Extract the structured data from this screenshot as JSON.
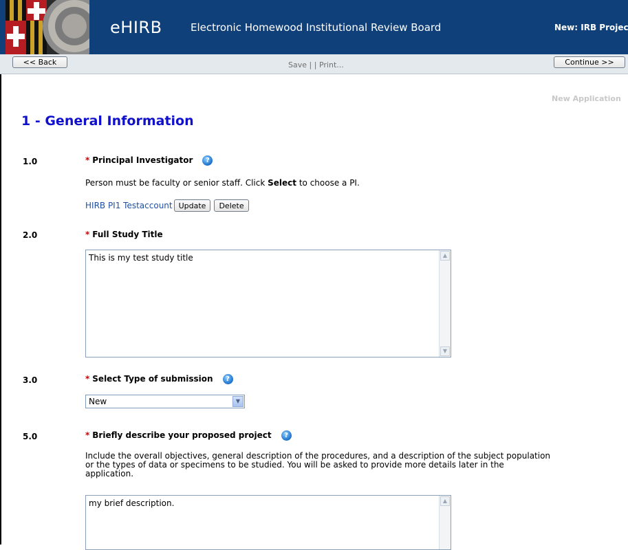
{
  "header": {
    "brand": "eHIRB",
    "subtitle": "Electronic Homewood Institutional Review Board",
    "right_title": "New: IRB Projec"
  },
  "toolbar": {
    "back_label": "<< Back",
    "save_label": "Save",
    "separator": "|",
    "print_label": "Print...",
    "continue_label": "Continue >>"
  },
  "page": {
    "new_application": "New Application",
    "section_title": "1 - General Information"
  },
  "questions": {
    "q1": {
      "number": "1.0",
      "required_mark": "*",
      "label": "Principal Investigator",
      "desc_before": "Person must be faculty or senior staff. Click ",
      "desc_bold": "Select",
      "desc_after": " to choose a PI.",
      "pi_name": "HIRB PI1 Testaccount",
      "update_label": "Update",
      "delete_label": "Delete"
    },
    "q2": {
      "number": "2.0",
      "required_mark": "*",
      "label": "Full Study Title",
      "value": "This is my test study title"
    },
    "q3": {
      "number": "3.0",
      "required_mark": "*",
      "label": "Select Type of submission",
      "selected": "New"
    },
    "q5": {
      "number": "5.0",
      "required_mark": "*",
      "label": "Briefly describe your proposed project",
      "desc_line1": "Include the overall objectives, general description of the procedures, and a description of the subject population",
      "desc_line2": "or the types of data or specimens to be studied.  You will be asked to provide more details later in the",
      "desc_line3": "application.",
      "value": "my brief description."
    }
  },
  "colors": {
    "header_bg": "#10407a",
    "section_title": "#1010cc",
    "required": "#cc0000",
    "link": "#1f4f9e"
  }
}
